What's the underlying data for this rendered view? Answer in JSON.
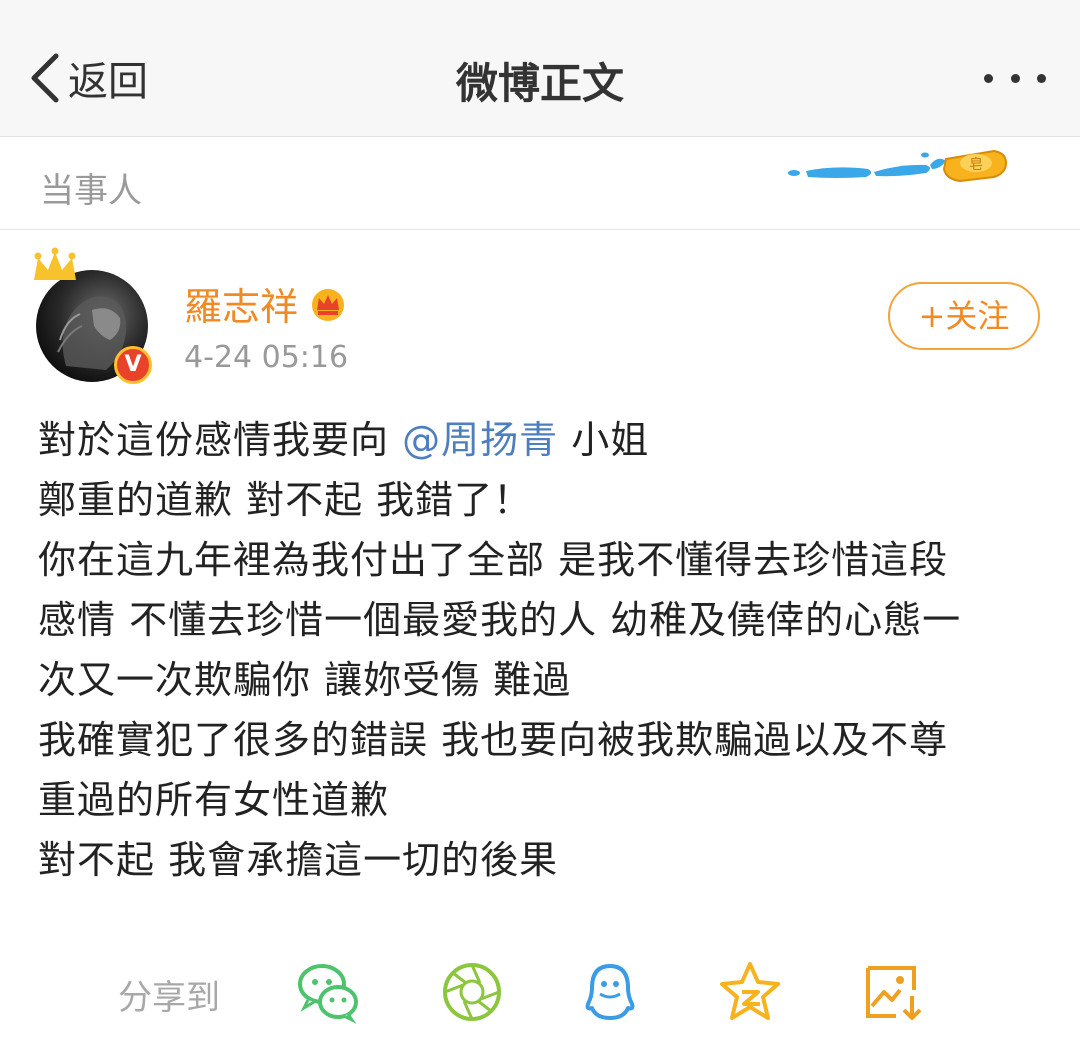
{
  "nav": {
    "back_label": "返回",
    "title": "微博正文"
  },
  "topic": {
    "label": "当事人",
    "deco_badge": "皂"
  },
  "post": {
    "username": "羅志祥",
    "verified_badge": "V",
    "time": "4-24 05:16",
    "follow_label": "+关注",
    "lines": {
      "l1_before": "對於這份感情我要向 ",
      "l1_mention": "@周扬青",
      "l1_after": " 小姐",
      "l2": "鄭重的道歉 對不起 我錯了！",
      "l3": "你在這九年裡為我付出了全部 是我不懂得去珍惜這段",
      "l4": "感情 不懂去珍惜一個最愛我的人 幼稚及僥倖的心態一",
      "l5": "次又一次欺騙你 讓妳受傷 難過",
      "l6": "我確實犯了很多的錯誤 我也要向被我欺騙過以及不尊",
      "l7": "重過的所有女性道歉",
      "l8": "對不起   我會承擔這一切的後果"
    }
  },
  "share": {
    "label": "分享到",
    "targets": [
      "wechat-icon",
      "moments-icon",
      "qq-icon",
      "qzone-icon",
      "save-image-icon"
    ]
  },
  "colors": {
    "accent_orange": "#f08a24",
    "link_blue": "#4d7fbf",
    "wechat_green": "#4cc36c",
    "qq_blue": "#3a9be6"
  }
}
